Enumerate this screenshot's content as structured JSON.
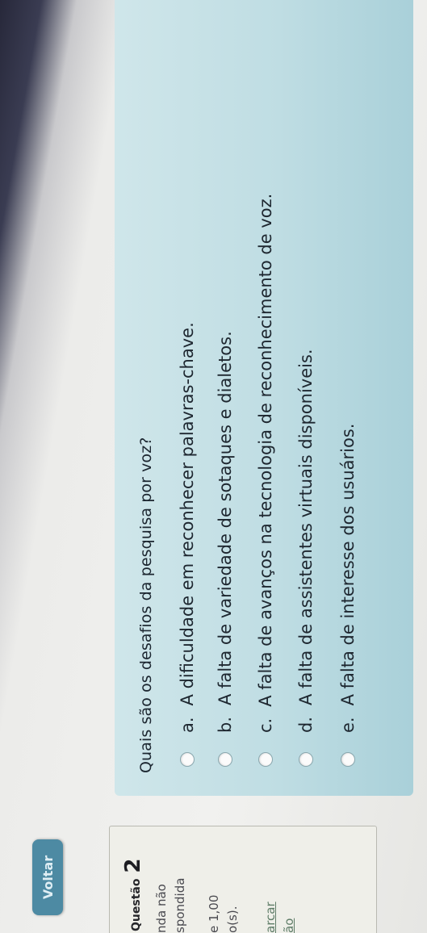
{
  "nav": {
    "back_label": "Voltar"
  },
  "question_info": {
    "label": "Questão",
    "number": "2",
    "status_line1": "nda não",
    "status_line2": "spondida",
    "grade": "e 1,00",
    "grade_suffix": "o(s).",
    "flag_link": "arcar",
    "flag_link2": "ão"
  },
  "question": {
    "text": "Quais são os desafios da pesquisa por voz?",
    "options": [
      {
        "letter": "a.",
        "text": "A dificuldade em reconhecer palavras-chave."
      },
      {
        "letter": "b.",
        "text": "A falta de variedade de sotaques e dialetos."
      },
      {
        "letter": "c.",
        "text": "A falta de avanços na tecnologia de reconhecimento de voz."
      },
      {
        "letter": "d.",
        "text": "A falta de assistentes virtuais disponíveis."
      },
      {
        "letter": "e.",
        "text": "A falta de interesse dos usuários."
      }
    ]
  },
  "colors": {
    "back_button": "#4d8aa3",
    "panel": "#bfdde3",
    "link": "#5f7d68"
  }
}
